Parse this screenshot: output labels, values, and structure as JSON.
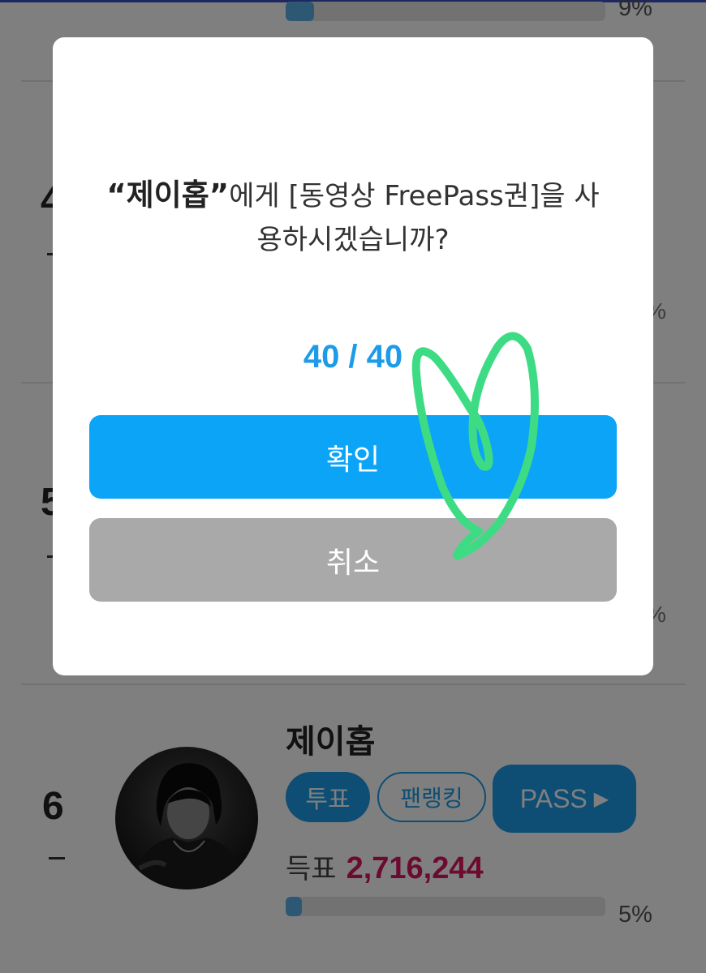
{
  "background": {
    "top_row": {
      "percent_text": "9%",
      "progress_fraction": 0.09
    },
    "row_4": {
      "rank_fragment": "4",
      "pct_fragment": "%"
    },
    "row_5": {
      "rank_fragment": "5",
      "pct_fragment": "%"
    },
    "row_6": {
      "rank": "6",
      "rank_change": "–",
      "artist_name": "제이홉",
      "vote_button": "투표",
      "fan_ranking_button": "팬랭킹",
      "pass_button": "PASS",
      "pass_arrow": "▶",
      "votes_label": "득표",
      "votes_count": "2,716,244",
      "percent_text": "5%",
      "progress_fraction": 0.05
    }
  },
  "dialog": {
    "name": "“제이홉”",
    "message_1": "에게 [동영상 FreePass권]을 사",
    "message_2": "용하시겠습니까?",
    "counter": "40 / 40",
    "confirm_label": "확인",
    "cancel_label": "취소"
  },
  "colors": {
    "accent_blue": "#0ba4f7",
    "cancel_gray": "#a9a9a9",
    "votes_red": "#d8175f",
    "doodle_green": "#3ddc84"
  },
  "icons": {
    "pass_arrow": "play-triangle-icon",
    "doodle": "heart-doodle-icon"
  }
}
